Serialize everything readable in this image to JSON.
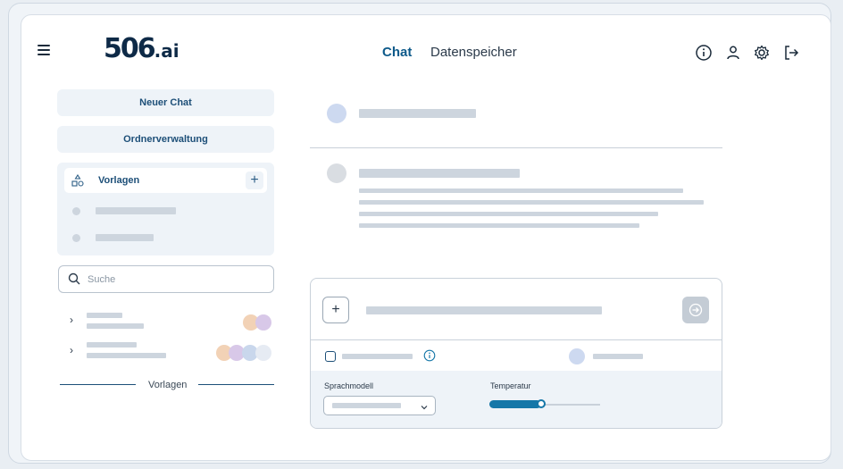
{
  "header": {
    "logo_text": "506",
    "logo_suffix": ".ai",
    "tabs": [
      {
        "label": "Chat",
        "active": true
      },
      {
        "label": "Datenspeicher",
        "active": false
      }
    ],
    "icons": [
      "info-icon",
      "user-icon",
      "settings-icon",
      "logout-icon"
    ]
  },
  "sidebar": {
    "new_chat_label": "Neuer Chat",
    "folder_label": "Ordnerverwaltung",
    "templates_label": "Vorlagen",
    "add_label": "+",
    "search_placeholder": "Suche",
    "divider_label": "Vorlagen"
  },
  "composer": {
    "add_label": "+",
    "model_label": "Sprachmodell",
    "temperature_label": "Temperatur",
    "temperature_level": 0.47
  },
  "colors": {
    "accent": "#1577a8",
    "brand": "#0e2a47",
    "chat_avatar": "#cdd9f0",
    "assistant_avatar": "#d9dde2",
    "chat_circles_1": [
      "#f2d2b6",
      "#d8c8e8"
    ],
    "chat_circles_2": [
      "#f2d2b6",
      "#d8c8e8",
      "#c9d7ec",
      "#e6ebf3"
    ]
  }
}
